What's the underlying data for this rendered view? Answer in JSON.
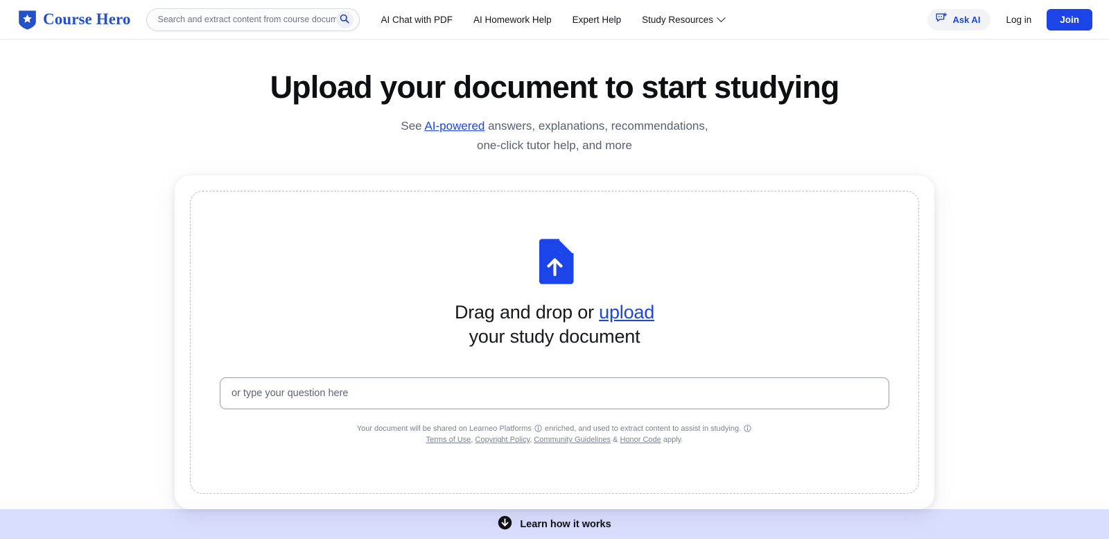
{
  "header": {
    "logo": {
      "text": "Course Hero",
      "icon": "shield-star-icon",
      "color": "#2451c7"
    },
    "search": {
      "placeholder": "Search and extract content from course documents,",
      "value": "",
      "icon": "search-icon"
    },
    "nav": [
      {
        "label": "AI Chat with PDF",
        "has_chevron": false
      },
      {
        "label": "AI Homework Help",
        "has_chevron": false
      },
      {
        "label": "Expert Help",
        "has_chevron": false
      },
      {
        "label": "Study Resources",
        "has_chevron": true
      }
    ],
    "ask_ai": {
      "label": "Ask AI",
      "icon": "chat-plus-icon",
      "color": "#1b45e8"
    },
    "login": {
      "label": "Log in"
    },
    "join": {
      "label": "Join",
      "color": "#1b45e8"
    }
  },
  "main": {
    "title": "Upload your document to start studying",
    "subtitle_before": "See ",
    "subtitle_link": "AI-powered",
    "subtitle_after": " answers, explanations, recommendations,",
    "subtitle_line2": "one-click tutor help, and more",
    "dropzone": {
      "icon": "document-upload-icon",
      "line1_before": "Drag and drop or ",
      "line1_link": "upload",
      "line2": "your study document",
      "question_placeholder": "or type your question here",
      "question_value": ""
    },
    "fineprint": {
      "line1_part1": "Your document will be shared on Learneo Platforms",
      "line1_part2": "enriched, and used to extract content to assist in studying.",
      "info_icon": "info-icon",
      "links": [
        {
          "label": "Terms of Use",
          "sep": ", "
        },
        {
          "label": "Copyright Policy",
          "sep": ", "
        },
        {
          "label": "Community Guidelines",
          "sep": " & "
        },
        {
          "label": "Honor Code",
          "sep": " "
        }
      ],
      "line2_tail": "apply."
    }
  },
  "footer": {
    "label": "Learn how it works",
    "icon": "arrow-down-circle-icon",
    "bg": "#d9defc"
  }
}
